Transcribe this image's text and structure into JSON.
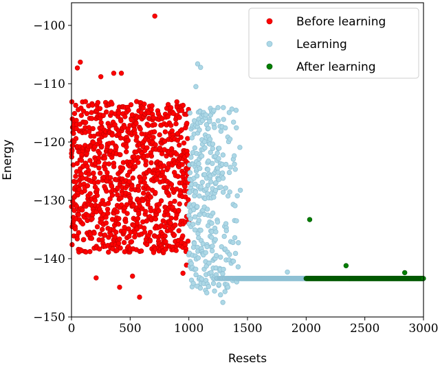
{
  "chart_data": {
    "type": "scatter",
    "title": "",
    "xlabel": "Resets",
    "ylabel": "Energy",
    "xlim": [
      0,
      3000
    ],
    "ylim": [
      -150,
      -96
    ],
    "grid": false,
    "legend_placement": "top-right",
    "xticks": [
      0,
      500,
      1000,
      1500,
      2000,
      2500,
      3000
    ],
    "xtick_labels": [
      "0",
      "500",
      "1000",
      "1500",
      "2000",
      "2500",
      "3000"
    ],
    "yticks": [
      -100,
      -110,
      -120,
      -130,
      -140,
      -150
    ],
    "ytick_labels": [
      "−100",
      "−110",
      "−120",
      "−130",
      "−140",
      "−150"
    ],
    "series": [
      {
        "name": "Before learning",
        "color": "#ff0000",
        "edge_color": "#cc0000",
        "x_range": [
          0,
          999
        ],
        "count": 1000,
        "distribution": "uniform random energies mostly between -139 and -113, sparse outliers",
        "core_energy_range": [
          -139,
          -113
        ],
        "notable_points": [
          {
            "x": 710,
            "y": -98.4
          },
          {
            "x": 50,
            "y": -107.3
          },
          {
            "x": 75,
            "y": -106.3
          },
          {
            "x": 250,
            "y": -108.8
          },
          {
            "x": 360,
            "y": -108.2
          },
          {
            "x": 425,
            "y": -108.2
          },
          {
            "x": 580,
            "y": -146.6
          },
          {
            "x": 210,
            "y": -143.3
          },
          {
            "x": 410,
            "y": -144.9
          },
          {
            "x": 980,
            "y": -141.1
          },
          {
            "x": 5,
            "y": -137.6
          },
          {
            "x": 520,
            "y": -143.0
          },
          {
            "x": 950,
            "y": -142.5
          }
        ]
      },
      {
        "name": "Learning",
        "color": "#add8e6",
        "edge_color": "#8fc0d4",
        "x_range": [
          1000,
          1999
        ],
        "count": 1000,
        "distribution": "scattered energies -147 to -107 for resets 1000-1400, converging to a plateau at -143.4 from about 1450 onward",
        "plateau_energy": -143.4,
        "notable_points": [
          {
            "x": 1075,
            "y": -106.6
          },
          {
            "x": 1100,
            "y": -107.2
          },
          {
            "x": 1290,
            "y": -147.5
          },
          {
            "x": 1270,
            "y": -146.2
          },
          {
            "x": 1840,
            "y": -142.3
          },
          {
            "x": 1060,
            "y": -110.5
          }
        ]
      },
      {
        "name": "After learning",
        "color": "#008000",
        "edge_color": "#005a00",
        "x_range": [
          2000,
          2999
        ],
        "count": 1000,
        "distribution": "almost all at plateau -143.4 with few outliers",
        "plateau_energy": -143.4,
        "notable_points": [
          {
            "x": 2030,
            "y": -133.3
          },
          {
            "x": 2340,
            "y": -141.2
          },
          {
            "x": 2840,
            "y": -142.4
          }
        ]
      }
    ]
  }
}
